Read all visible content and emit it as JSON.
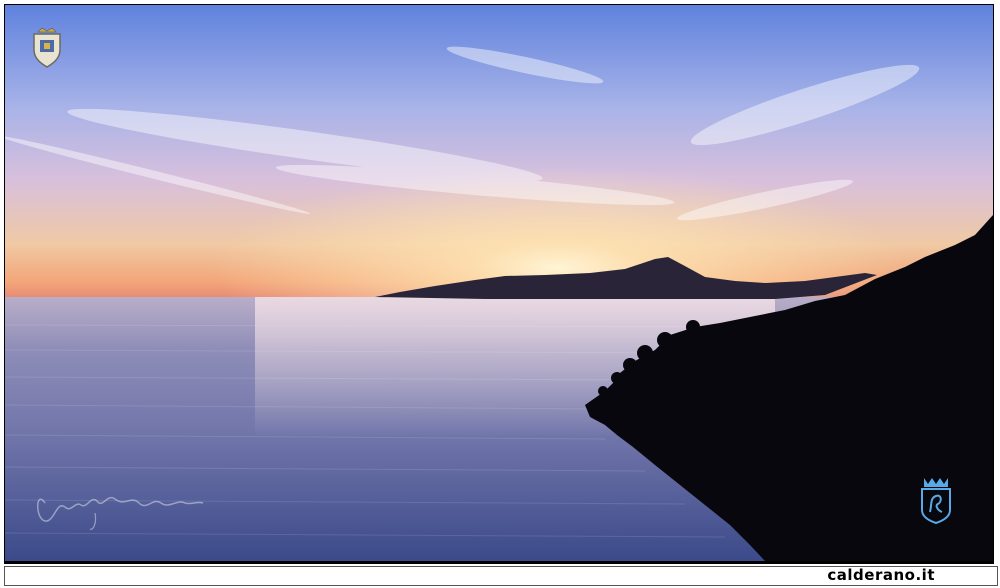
{
  "site": {
    "label": "calderano.it"
  },
  "scene": {
    "subject": "sunset-over-sea",
    "colors": {
      "sky_top": "#6f8fe0",
      "sky_mid": "#c3b7e5",
      "horizon": "#f0a070",
      "sun": "#fff2c8",
      "sea": "#5a6aa0",
      "silhouette": "#0b0b12"
    }
  },
  "overlays": {
    "crest_icon": "coat-of-arms-icon",
    "badge_icon": "blue-crown-shield-icon",
    "signature_icon": "handwritten-signature"
  }
}
